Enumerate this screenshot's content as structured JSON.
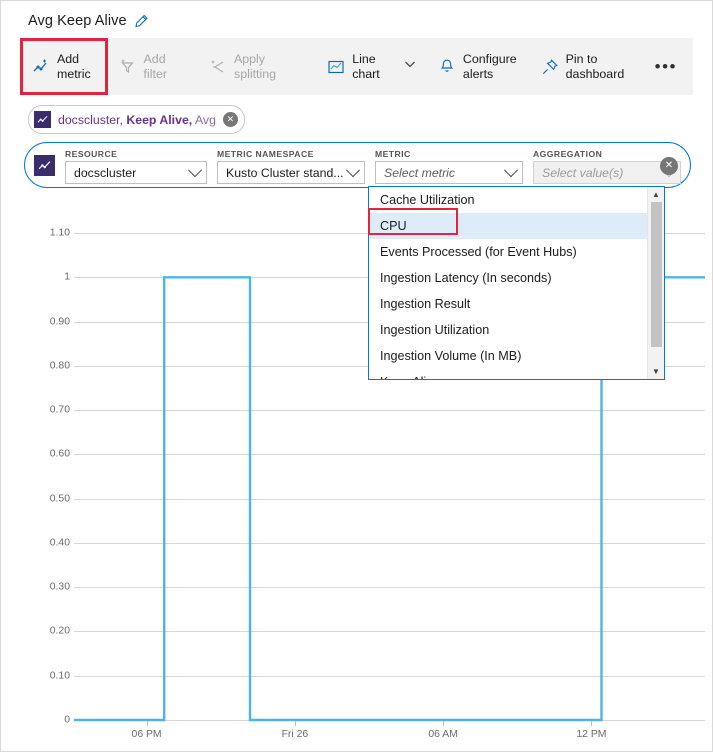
{
  "window": {
    "title": "Avg Keep Alive",
    "edit_icon": "pencil-icon"
  },
  "toolbar": {
    "items": [
      {
        "label_line1": "Add",
        "label_line2": "metric",
        "icon": "add-metric-icon",
        "disabled": false,
        "highlighted": true
      },
      {
        "label_line1": "Add",
        "label_line2": "filter",
        "icon": "add-filter-icon",
        "disabled": true,
        "highlighted": false
      },
      {
        "label_line1": "Apply",
        "label_line2": "splitting",
        "icon": "apply-splitting-icon",
        "disabled": true,
        "highlighted": false
      },
      {
        "label_line1": "Line",
        "label_line2": "chart",
        "icon": "line-chart-icon",
        "disabled": false,
        "highlighted": false
      },
      {
        "label_line1": "Configure",
        "label_line2": "alerts",
        "icon": "bell-icon",
        "disabled": false,
        "highlighted": false
      },
      {
        "label_line1": "Pin to",
        "label_line2": "dashboard",
        "icon": "pin-icon",
        "disabled": false,
        "highlighted": false
      }
    ],
    "chart_type_caret": "chevron-down-icon",
    "more_label": "•••"
  },
  "metric_chip": {
    "resource": "docscluster,",
    "metric": "Keep Alive,",
    "aggregation": "Avg",
    "close_label": "✕",
    "square_icon": "metric-chart-icon"
  },
  "picker": {
    "square_icon": "metric-chart-icon",
    "fields": [
      {
        "label": "RESOURCE",
        "value": "docscluster",
        "state": "filled"
      },
      {
        "label": "METRIC NAMESPACE",
        "value": "Kusto Cluster stand...",
        "state": "filled"
      },
      {
        "label": "METRIC",
        "value": "Select metric",
        "state": "placeholder"
      },
      {
        "label": "AGGREGATION",
        "value": "Select value(s)",
        "state": "disabled"
      }
    ],
    "close_label": "✕"
  },
  "dropdown": {
    "options": [
      "Cache Utilization",
      "CPU",
      "Events Processed (for Event Hubs)",
      "Ingestion Latency (In seconds)",
      "Ingestion Result",
      "Ingestion Utilization",
      "Ingestion Volume (In MB)",
      "Keep Alive"
    ],
    "selected_index": 1,
    "highlighted_option": "CPU",
    "scroll_up": "▲",
    "scroll_down": "▼"
  },
  "colors": {
    "accent_blue": "#0078d4",
    "series_blue": "#4FB3E8",
    "highlight_red": "#e2243c",
    "chip_purple": "#68308f",
    "chip_square": "#3b2c6e",
    "selected_row": "#deecf9"
  },
  "chart_data": {
    "type": "line",
    "title": "Avg Keep Alive",
    "xlabel": "",
    "ylabel": "",
    "ylim": [
      0,
      1.1
    ],
    "grid": true,
    "legend": "none",
    "ytick_labels": [
      "1.10",
      "1",
      "0.90",
      "0.80",
      "0.70",
      "0.60",
      "0.50",
      "0.40",
      "0.30",
      "0.20",
      "0.10",
      "0"
    ],
    "ytick_values": [
      1.1,
      1.0,
      0.9,
      0.8,
      0.7,
      0.6,
      0.5,
      0.4,
      0.3,
      0.2,
      0.1,
      0
    ],
    "xtick_labels": [
      "06 PM",
      "Fri 26",
      "06 AM",
      "12 PM"
    ],
    "xtick_fracs": [
      0.115,
      0.35,
      0.585,
      0.82
    ],
    "series": [
      {
        "name": "Avg Keep Alive",
        "color": "#4FB3E8",
        "points": [
          {
            "x": 0.0,
            "y": 0
          },
          {
            "x": 0.143,
            "y": 0
          },
          {
            "x": 0.143,
            "y": 1
          },
          {
            "x": 0.279,
            "y": 1
          },
          {
            "x": 0.279,
            "y": 0
          },
          {
            "x": 0.836,
            "y": 0
          },
          {
            "x": 0.836,
            "y": 1
          },
          {
            "x": 1.0,
            "y": 1
          }
        ]
      }
    ]
  }
}
